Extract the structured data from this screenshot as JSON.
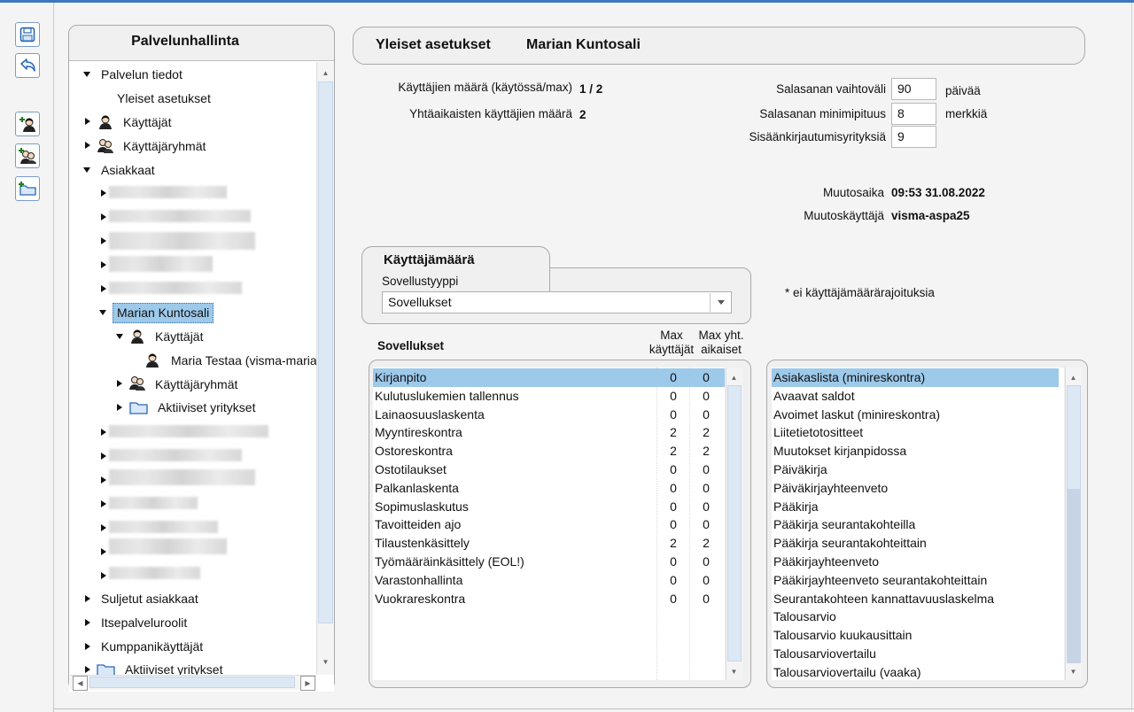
{
  "tree": {
    "title": "Palvelunhallinta",
    "items": [
      {
        "label": "Palvelun tiedot"
      },
      {
        "label": "Yleiset asetukset"
      },
      {
        "label": "Käyttäjät"
      },
      {
        "label": "Käyttäjäryhmät"
      },
      {
        "label": "Asiakkaat"
      },
      {
        "label": "Marian Kuntosali"
      },
      {
        "label": "Käyttäjät"
      },
      {
        "label": "Maria Testaa (visma-maria"
      },
      {
        "label": "Käyttäjäryhmät"
      },
      {
        "label": "Aktiiviset yritykset"
      },
      {
        "label": "Suljetut asiakkaat"
      },
      {
        "label": "Itsepalveluroolit"
      },
      {
        "label": "Kumppanikäyttäjät"
      },
      {
        "label": "Aktiiviset yritykset"
      }
    ]
  },
  "header": {
    "section": "Yleiset asetukset",
    "customer": "Marian Kuntosali"
  },
  "info": {
    "users_label": "Käyttäjien määrä (käytössä/max)",
    "users_value": "1 / 2",
    "concurrent_label": "Yhtäaikaisten käyttäjien määrä",
    "concurrent_value": "2",
    "pw_interval_label": "Salasanan vaihtoväli",
    "pw_interval_value": "90",
    "pw_interval_unit": "päivää",
    "pw_min_label": "Salasanan minimipituus",
    "pw_min_value": "8",
    "pw_min_unit": "merkkiä",
    "login_attempts_label": "Sisäänkirjautumisyrityksiä",
    "login_attempts_value": "9",
    "modified_time_label": "Muutosaika",
    "modified_time_value": "09:53 31.08.2022",
    "modified_user_label": "Muutoskäyttäjä",
    "modified_user_value": "visma-aspa25"
  },
  "usercount": {
    "title": "Käyttäjämäärä",
    "type_label": "Sovellustyyppi",
    "type_value": "Sovellukset",
    "note": "* ei käyttäjämäärärajoituksia"
  },
  "apps": {
    "header_name": "Sovellukset",
    "header_max1": "Max",
    "header_max2": "käyttäjät",
    "header_maxc1": "Max yht.",
    "header_maxc2": "aikaiset",
    "rows": [
      {
        "name": "Kirjanpito",
        "max": "0",
        "conc": "0"
      },
      {
        "name": "Kulutuslukemien tallennus",
        "max": "0",
        "conc": "0"
      },
      {
        "name": "Lainaosuuslaskenta",
        "max": "0",
        "conc": "0"
      },
      {
        "name": "Myyntireskontra",
        "max": "2",
        "conc": "2"
      },
      {
        "name": "Ostoreskontra",
        "max": "2",
        "conc": "2"
      },
      {
        "name": "Ostotilaukset",
        "max": "0",
        "conc": "0"
      },
      {
        "name": "Palkanlaskenta",
        "max": "0",
        "conc": "0"
      },
      {
        "name": "Sopimuslaskutus",
        "max": "0",
        "conc": "0"
      },
      {
        "name": "Tavoitteiden ajo",
        "max": "0",
        "conc": "0"
      },
      {
        "name": "Tilaustenkäsittely",
        "max": "2",
        "conc": "2"
      },
      {
        "name": "Työmääräinkäsittely (EOL!)",
        "max": "0",
        "conc": "0"
      },
      {
        "name": "Varastonhallinta",
        "max": "0",
        "conc": "0"
      },
      {
        "name": "Vuokrareskontra",
        "max": "0",
        "conc": "0"
      }
    ]
  },
  "reports": [
    "Asiakaslista (minireskontra)",
    "Avaavat saldot",
    "Avoimet laskut (minireskontra)",
    "Liitetietotositteet",
    "Muutokset kirjanpidossa",
    "Päiväkirja",
    "Päiväkirjayhteenveto",
    "Pääkirja",
    "Pääkirja seurantakohteilla",
    "Pääkirja seurantakohteittain",
    "Pääkirjayhteenveto",
    "Pääkirjayhteenveto seurantakohteittain",
    "Seurantakohteen kannattavuuslaskelma",
    "Talousarvio",
    "Talousarvio kuukausittain",
    "Talousarviovertailu",
    "Talousarviovertailu (vaaka)"
  ]
}
